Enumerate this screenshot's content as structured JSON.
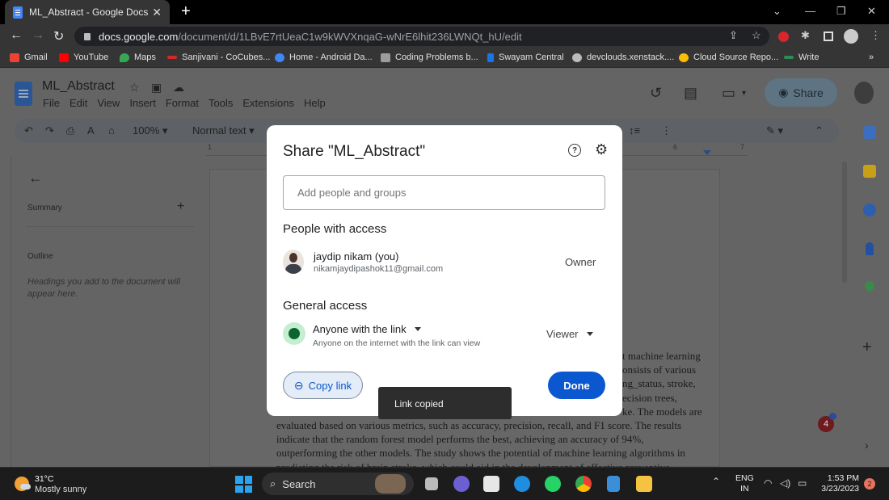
{
  "browser": {
    "tab_title": "ML_Abstract - Google Docs",
    "url_host": "docs.google.com",
    "url_path": "/document/d/1LBvE7rtUeaC1w9kWVXnqaG-wNrE6lhit236LWNQt_hU/edit",
    "new_tab_label": "+",
    "bookmarks": [
      {
        "label": "Gmail",
        "color": "#ea4335"
      },
      {
        "label": "YouTube",
        "color": "#ff0000"
      },
      {
        "label": "Maps",
        "color": "#34a853"
      },
      {
        "label": "Sanjivani - CoCubes...",
        "color": "#d12a2a"
      },
      {
        "label": "Home - Android Da...",
        "color": "#4285f4"
      },
      {
        "label": "Coding Problems b...",
        "color": "#9c9c9c"
      },
      {
        "label": "Swayam Central",
        "color": "#1a73e8"
      },
      {
        "label": "devclouds.xenstack....",
        "color": "#bbbbbb"
      },
      {
        "label": "Cloud Source Repo...",
        "color": "#fbbc04"
      },
      {
        "label": "Write",
        "color": "#2e8b57"
      }
    ],
    "bookmarks_more": "»"
  },
  "docs": {
    "title": "ML_Abstract",
    "menus": [
      "File",
      "Edit",
      "View",
      "Insert",
      "Format",
      "Tools",
      "Extensions",
      "Help"
    ],
    "share_label": "Share",
    "zoom": "100%",
    "style": "Normal text",
    "ruler_ticks": [
      "1",
      "6",
      "7"
    ],
    "outline": {
      "summary_label": "Summary",
      "outline_label": "Outline",
      "hint": "Headings you add to the document will appear here."
    },
    "body_lines": [
      "t machine learning",
      "onsists of various",
      "ng_status, stroke,",
      "ecision trees,",
      "ke. The models are",
      "evaluated based on various metrics, such as accuracy, precision, recall, and F1 score. The results",
      "indicate that the random forest model performs the best, achieving an accuracy of 94%,",
      "outperforming the other models. The study shows the potential of machine learning algorithms in",
      "predicting the risk of brain stroke, which could aid in the development of effective preventive"
    ],
    "notification_count": "4"
  },
  "share_dialog": {
    "title": "Share \"ML_Abstract\"",
    "input_placeholder": "Add people and groups",
    "people_heading": "People with access",
    "person": {
      "name": "jaydip nikam (you)",
      "email": "nikamjaydipashok11@gmail.com",
      "role": "Owner"
    },
    "general_heading": "General access",
    "access_level": "Anyone with the link",
    "access_desc": "Anyone on the internet with the link can view",
    "permission": "Viewer",
    "copy_link_label": "Copy link",
    "done_label": "Done",
    "brand_color": "#0b57d0"
  },
  "toast": {
    "message": "Link copied"
  },
  "taskbar": {
    "temperature": "31°C",
    "weather": "Mostly sunny",
    "search_label": "Search",
    "lang_top": "ENG",
    "lang_bottom": "IN",
    "time": "1:53 PM",
    "date": "3/23/2023",
    "notifications": "2"
  }
}
